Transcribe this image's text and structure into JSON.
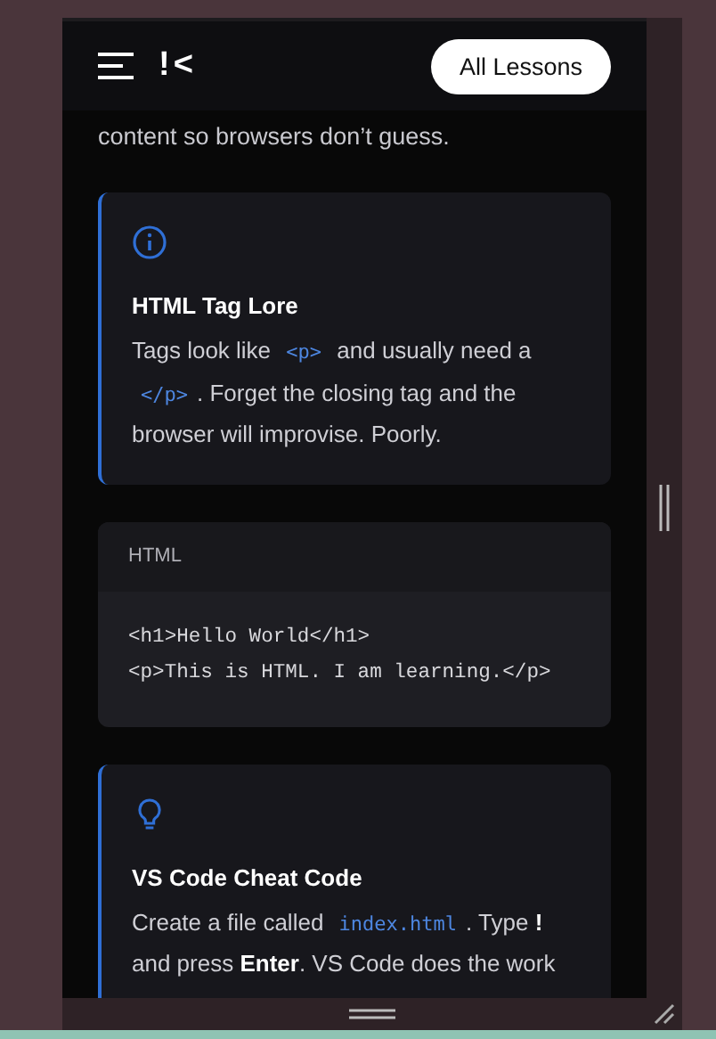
{
  "header": {
    "logo": "!<",
    "button": "All Lessons"
  },
  "intro_tail": "content so browsers don’t guess.",
  "blocks": [
    {
      "kind": "info",
      "title": "HTML Tag Lore",
      "parts": [
        {
          "kind": "text",
          "text": "Tags look like "
        },
        {
          "kind": "code",
          "text": "<p>"
        },
        {
          "kind": "text",
          "text": " and usually need a "
        },
        {
          "kind": "code",
          "text": "</p>"
        },
        {
          "kind": "text",
          "text": ". Forget the closing tag and the browser will improvise. Poorly."
        }
      ]
    },
    {
      "kind": "code",
      "language": "HTML",
      "lines": [
        "<h1>Hello World</h1>",
        "<p>This is HTML. I am learning.</p>"
      ]
    },
    {
      "kind": "tip",
      "title": "VS Code Cheat Code",
      "parts": [
        {
          "kind": "text",
          "text": "Create a file called "
        },
        {
          "kind": "code",
          "text": "index.html"
        },
        {
          "kind": "text",
          "text": ". Type **!** and press **Enter**. VS Code does the work"
        }
      ]
    }
  ]
}
